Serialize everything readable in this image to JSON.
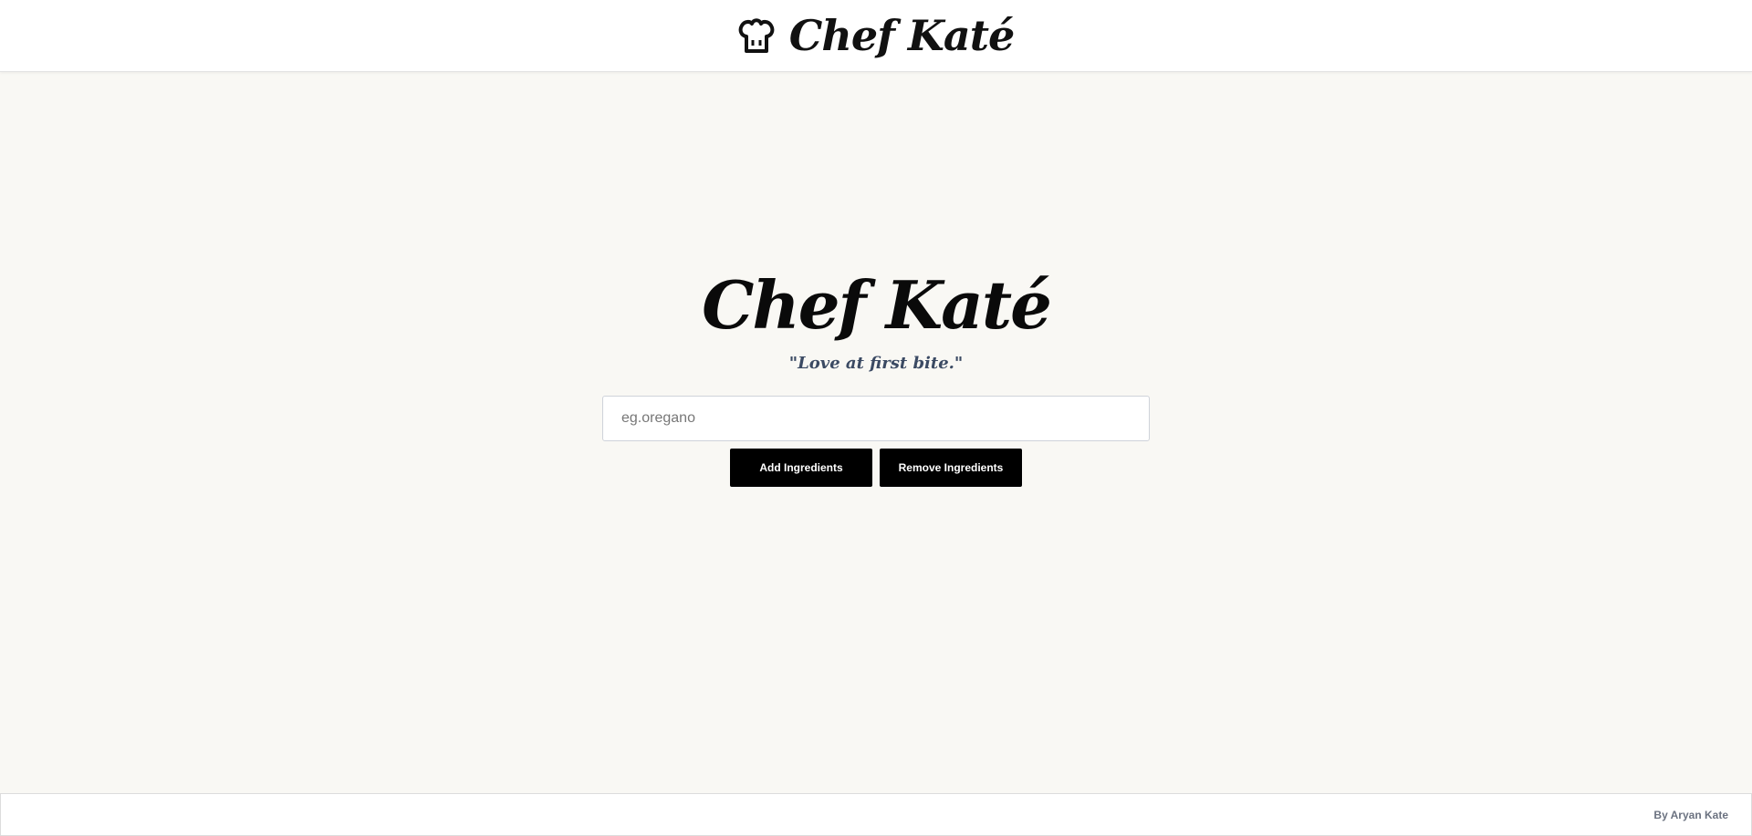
{
  "header": {
    "brand_title": "Chef Katé",
    "icon": "chef-hat-icon"
  },
  "hero": {
    "title": "Chef Katé",
    "tagline": "\"Love at first bite.\""
  },
  "search": {
    "value": "",
    "placeholder": "eg.oregano"
  },
  "actions": {
    "add_label": "Add Ingredients",
    "remove_label": "Remove Ingredients"
  },
  "footer": {
    "credit": "By Aryan Kate"
  },
  "colors": {
    "background": "#f9f8f4",
    "button": "#000000",
    "tagline": "#3b4a63"
  }
}
